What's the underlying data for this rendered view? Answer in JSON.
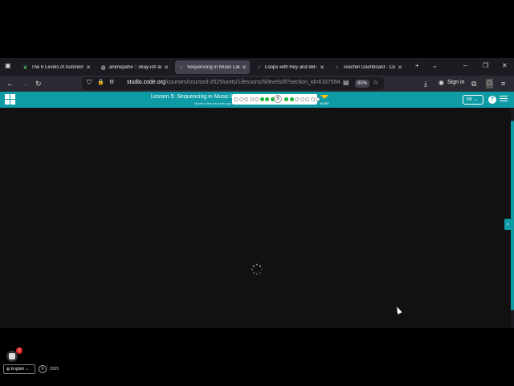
{
  "tabs": [
    {
      "label": "The 6 Levels of Autonomo",
      "icon": "leaf-icon",
      "active": false
    },
    {
      "label": "animepahe :: okay-ish ani",
      "icon": "globe-icon",
      "active": false
    },
    {
      "label": "Sequencing in Music Lab",
      "icon": "loading-icon",
      "active": true
    },
    {
      "label": "Loops with Rey and BB-8",
      "icon": "loading-icon",
      "active": false
    },
    {
      "label": "Teacher Dashboard - Cod",
      "icon": "loading-icon",
      "active": false
    }
  ],
  "navbar": {
    "url_host": "studio.code.org",
    "url_path": "/courses/coursed-2025/units/1/lessons/5/levels/8?section_id=6167594",
    "zoom": "80%",
    "signin_label": "Sign in"
  },
  "header": {
    "lesson_title": "Lesson 5: Sequencing in Music Lab",
    "lesson_subtitle": "Saved a few seconds ago",
    "current_level": "8",
    "more_label": "MORE",
    "lang_btn": "Mr",
    "help_glyph": "?"
  },
  "progress": {
    "before": [
      "todo",
      "todo",
      "todo",
      "todo",
      "todo",
      "done",
      "done",
      "done"
    ],
    "after": [
      "done",
      "done",
      "todo",
      "todo",
      "todo",
      "todo",
      "todo"
    ]
  },
  "footer": {
    "badge_count": "1",
    "language": "English",
    "year": "2025"
  },
  "colors": {
    "accent": "#0e9ba5",
    "done": "#1db83b",
    "more": "#ffc20e"
  }
}
